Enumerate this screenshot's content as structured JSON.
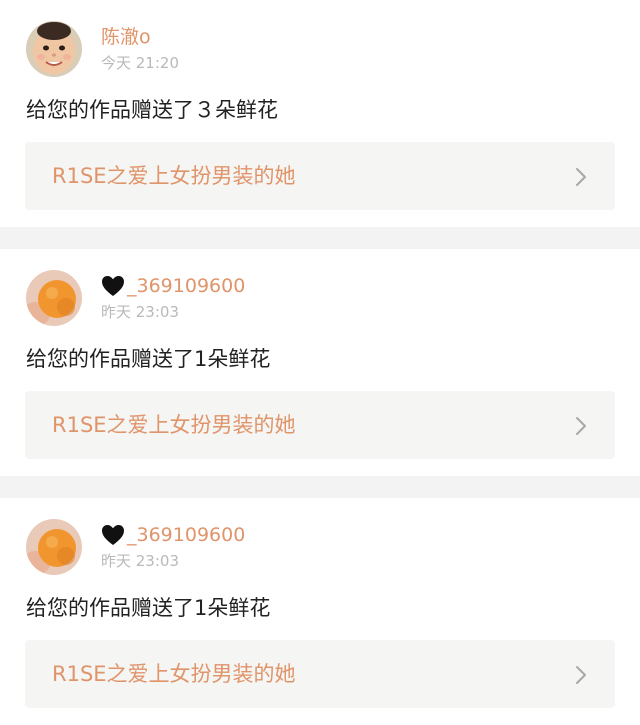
{
  "notifications": [
    {
      "username": "陈澈ο",
      "has_heart": false,
      "avatar": "baby-face-avatar",
      "time": "今天 21:20",
      "message": "给您的作品赠送了３朵鲜花",
      "work_title": "R1SE之爱上女扮男装的她"
    },
    {
      "username": "_369109600",
      "has_heart": true,
      "avatar": "orange-fruit-avatar",
      "time": "昨天 23:03",
      "message": "给您的作品赠送了1朵鲜花",
      "work_title": "R1SE之爱上女扮男装的她"
    },
    {
      "username": "_369109600",
      "has_heart": true,
      "avatar": "orange-fruit-avatar",
      "time": "昨天 23:03",
      "message": "给您的作品赠送了1朵鲜花",
      "work_title": "R1SE之爱上女扮男装的她"
    }
  ],
  "icons": {
    "heart": "black-heart-icon",
    "chevron": "chevron-right-icon"
  },
  "colors": {
    "accent": "#e0946a",
    "time": "#b9b9b9",
    "text": "#222222",
    "card_link_bg": "#f5f5f3",
    "separator": "#f3f3f3"
  }
}
